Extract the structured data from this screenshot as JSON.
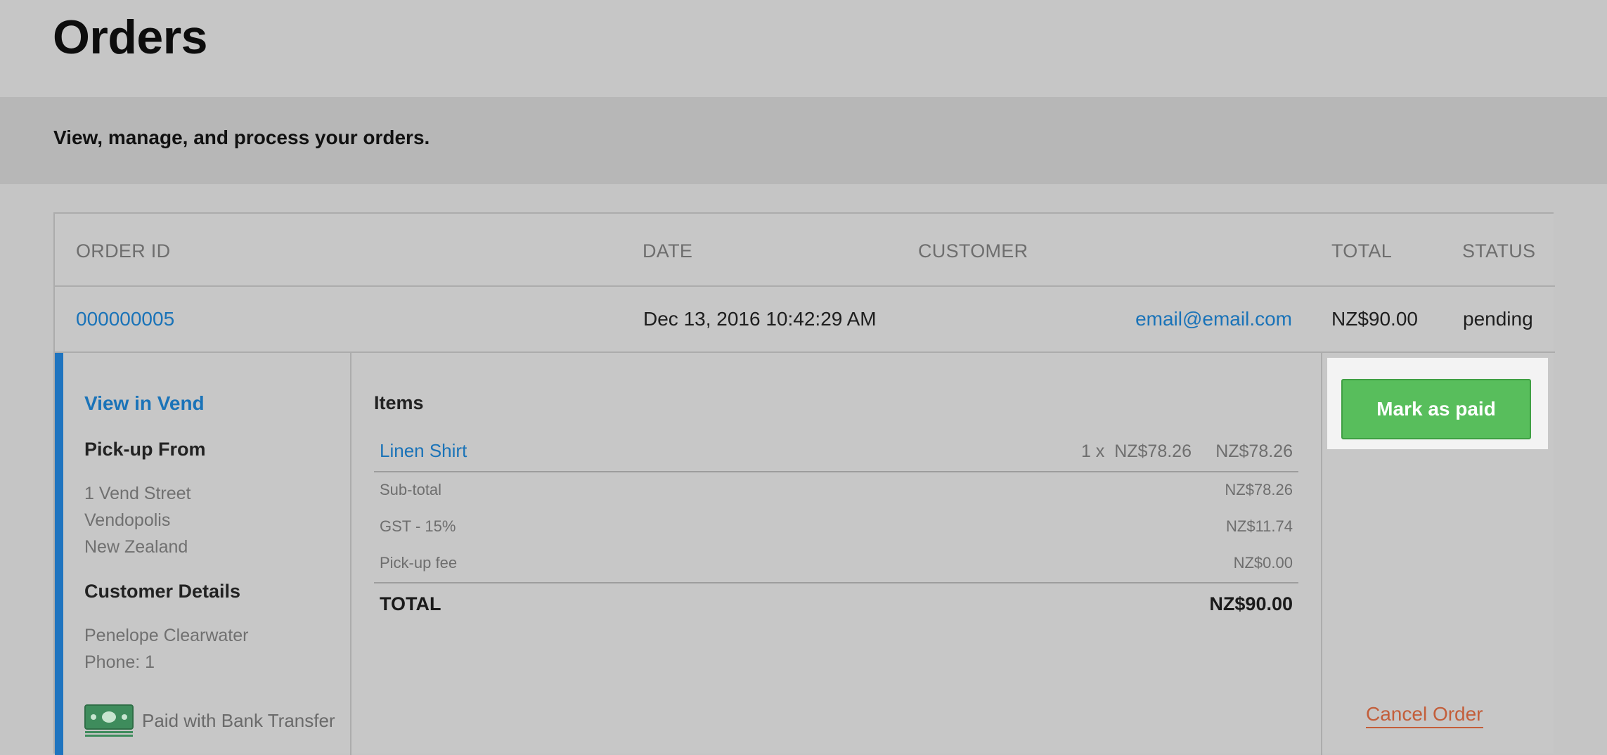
{
  "page": {
    "title": "Orders",
    "subtitle": "View, manage, and process your orders."
  },
  "table": {
    "headers": {
      "order_id": "ORDER ID",
      "date": "DATE",
      "customer": "CUSTOMER",
      "total": "TOTAL",
      "status": "STATUS"
    },
    "rows": [
      {
        "order_id": "000000005",
        "date": "Dec 13, 2016 10:42:29 AM",
        "customer": "email@email.com",
        "total": "NZ$90.00",
        "status": "pending"
      }
    ]
  },
  "detail": {
    "view_in_vend": "View in Vend",
    "pickup_heading": "Pick-up From",
    "pickup_address": [
      "1 Vend Street",
      "Vendopolis",
      "New Zealand"
    ],
    "customer_heading": "Customer Details",
    "customer_name": "Penelope Clearwater",
    "customer_phone": "Phone: 1",
    "payment_icon": "banknote-icon",
    "payment_method": "Paid with Bank Transfer",
    "items_heading": "Items",
    "items": [
      {
        "name": "Linen Shirt",
        "qty": "1 x",
        "unit_price": "NZ$78.26",
        "line_total": "NZ$78.26"
      }
    ],
    "summary": [
      {
        "label": "Sub-total",
        "value": "NZ$78.26"
      },
      {
        "label": "GST - 15%",
        "value": "NZ$11.74"
      },
      {
        "label": "Pick-up fee",
        "value": "NZ$0.00"
      }
    ],
    "total_label": "TOTAL",
    "total_value": "NZ$90.00",
    "mark_paid_label": "Mark as paid",
    "cancel_label": "Cancel Order"
  },
  "colors": {
    "accent_blue": "#1f74bf",
    "link_blue": "#1a73b8",
    "success_green": "#58be5c",
    "cancel_orange": "#c35e3a"
  }
}
